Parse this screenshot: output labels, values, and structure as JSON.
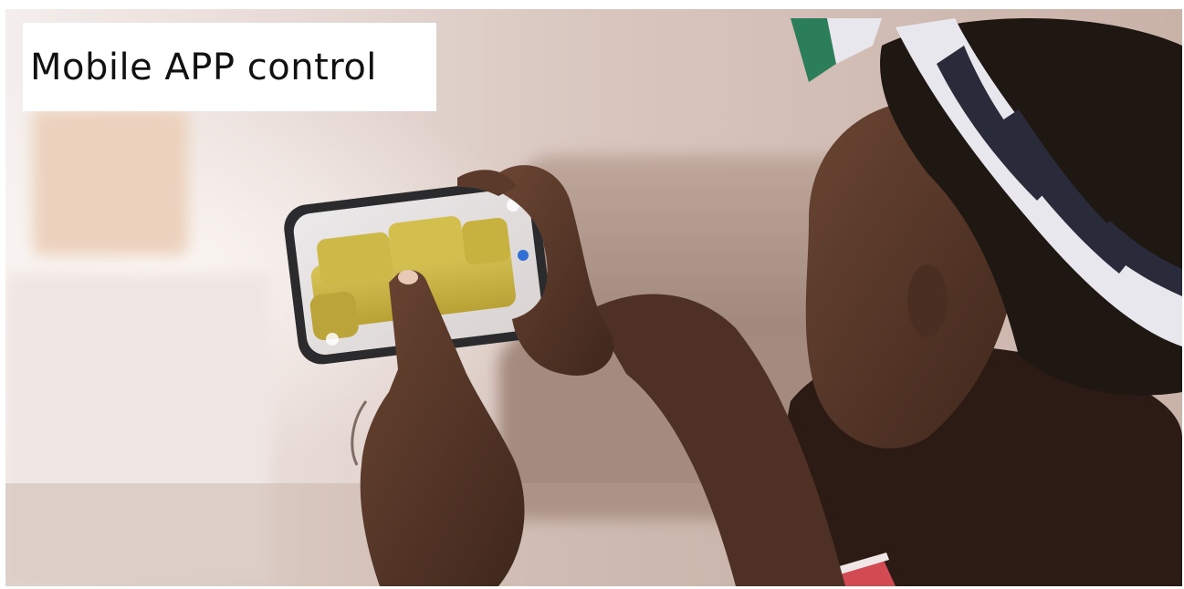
{
  "caption": {
    "title": "Mobile APP control"
  },
  "photo": {
    "subject": "person-using-phone-ar-app",
    "screen_object": "yellow-sofa"
  },
  "colors": {
    "wall": "#cdb7ad",
    "sofa": "#c9b441",
    "skin": "#5a3a2a",
    "headband_light": "#e9e7ee",
    "headband_dark": "#2a2b3a",
    "window_glow": "#f3ece8"
  }
}
